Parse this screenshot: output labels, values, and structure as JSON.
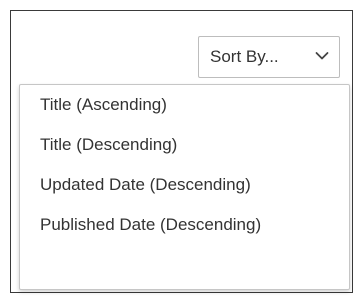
{
  "sort": {
    "label": "Sort By...",
    "icon": "chevron-down-icon",
    "options": [
      "Title (Ascending)",
      "Title (Descending)",
      "Updated Date (Descending)",
      "Published Date (Descending)"
    ]
  },
  "colors": {
    "text": "#333333",
    "panel_border": "#3a3a3a",
    "select_border": "#bdbdbd",
    "menu_border": "#c6c6c6",
    "background": "#ffffff"
  }
}
